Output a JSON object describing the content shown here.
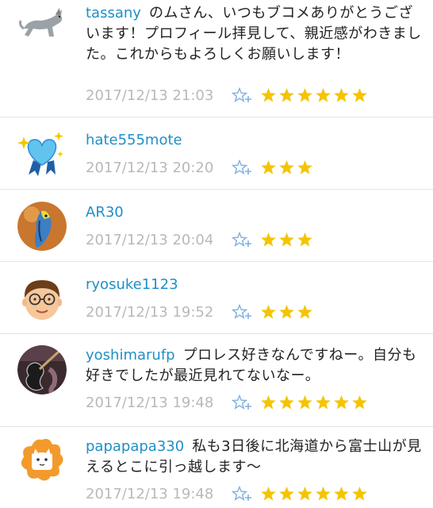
{
  "comments": [
    {
      "username": "tassany",
      "text": "のムさん、いつもブコメありがとうございます！プロフィール拝見して、親近感がわきました。これからもよろしくお願いします！",
      "date": "2017/12/13 21:03",
      "stars": 6,
      "avatar": "cat-avatar"
    },
    {
      "username": "hate555mote",
      "text": "",
      "date": "2017/12/13 20:20",
      "stars": 3,
      "avatar": "heart-ribbon-avatar"
    },
    {
      "username": "AR30",
      "text": "",
      "date": "2017/12/13 20:04",
      "stars": 3,
      "avatar": "parakeet-avatar"
    },
    {
      "username": "ryosuke1123",
      "text": "",
      "date": "2017/12/13 19:52",
      "stars": 3,
      "avatar": "glasses-face-avatar"
    },
    {
      "username": "yoshimarufp",
      "text": "プロレス好きなんですねー。自分も好きでしたが最近見れてないなー。",
      "date": "2017/12/13 19:48",
      "stars": 6,
      "avatar": "guitar-avatar"
    },
    {
      "username": "papapapa330",
      "text": "私も3日後に北海道から富士山が見えるとこに引っ越します〜",
      "date": "2017/12/13 19:48",
      "stars": 6,
      "avatar": "orange-cat-avatar"
    }
  ],
  "colors": {
    "username": "#1f8fc7",
    "date": "#b9b9b9",
    "star": "#f5c400",
    "add_star": "#7fb0e0"
  }
}
